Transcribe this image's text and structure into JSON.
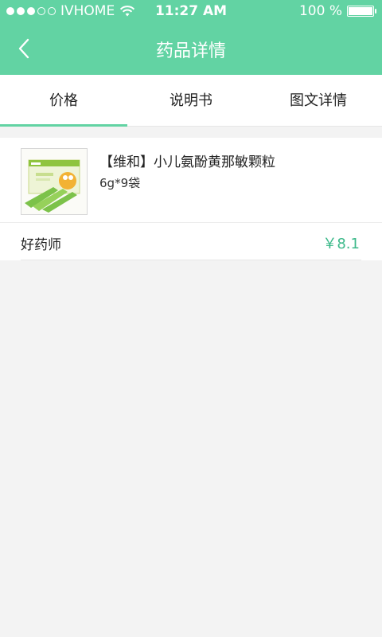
{
  "status_bar": {
    "carrier": "IVHOME",
    "time": "11:27 AM",
    "battery": "100 %"
  },
  "nav": {
    "title": "药品详情",
    "back_icon": "chevron-left-icon"
  },
  "tabs": [
    {
      "label": "价格",
      "active": true
    },
    {
      "label": "说明书",
      "active": false
    },
    {
      "label": "图文详情",
      "active": false
    }
  ],
  "product": {
    "name": "【维和】小儿氨酚黄那敏颗粒",
    "spec": "6g*9袋"
  },
  "offers": [
    {
      "seller": "好药师",
      "price": "￥8.1"
    }
  ],
  "colors": {
    "accent": "#62d3a3",
    "price": "#3cb98a",
    "background": "#f3f3f3"
  }
}
